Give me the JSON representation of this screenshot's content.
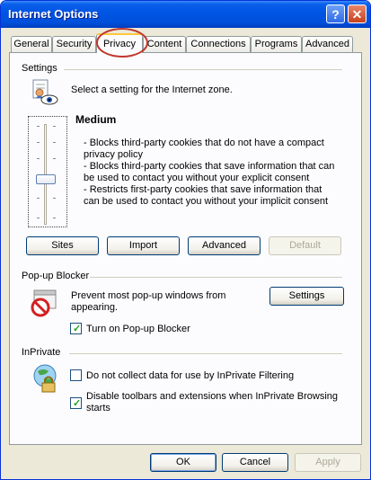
{
  "window": {
    "title": "Internet Options"
  },
  "tabs": [
    "General",
    "Security",
    "Privacy",
    "Content",
    "Connections",
    "Programs",
    "Advanced"
  ],
  "active_tab": "Privacy",
  "settings": {
    "heading": "Settings",
    "prompt": "Select a setting for the Internet zone.",
    "level": "Medium",
    "desc": [
      "- Blocks third-party cookies that do not have a compact",
      "privacy policy",
      "- Blocks third-party cookies that save information that can",
      "be used to contact you without your explicit consent",
      "- Restricts first-party cookies that save information that",
      "can be used to contact you without your implicit consent"
    ],
    "buttons": {
      "sites": "Sites",
      "import": "Import",
      "advanced": "Advanced",
      "default": "Default"
    }
  },
  "popup": {
    "heading": "Pop-up Blocker",
    "desc": [
      "Prevent most pop-up windows from",
      "appearing."
    ],
    "settings_button": "Settings",
    "checkbox_label": "Turn on Pop-up Blocker",
    "checkbox_checked": true
  },
  "inprivate": {
    "heading": "InPrivate",
    "option1": "Do not collect data for use by InPrivate Filtering",
    "option1_checked": false,
    "option2": [
      "Disable toolbars and extensions when InPrivate Browsing",
      "starts"
    ],
    "option2_checked": true
  },
  "footer": {
    "ok": "OK",
    "cancel": "Cancel",
    "apply": "Apply"
  }
}
